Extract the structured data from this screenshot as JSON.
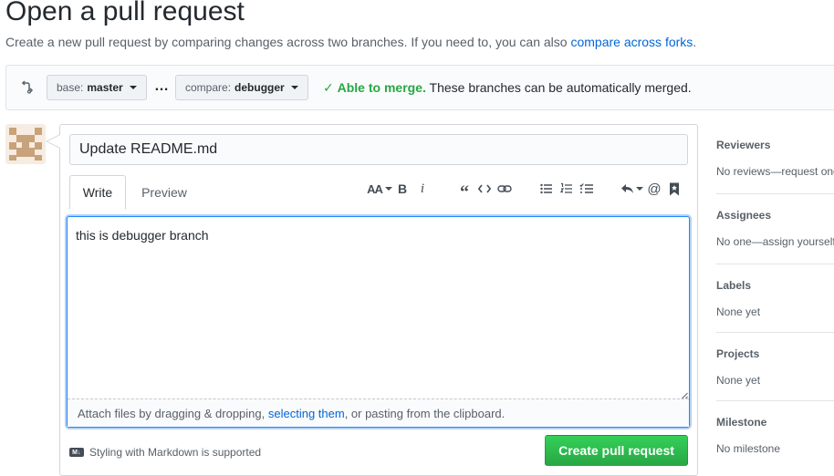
{
  "page": {
    "title": "Open a pull request",
    "subtitle_prefix": "Create a new pull request by comparing changes across two branches. If you need to, you can also ",
    "subtitle_link": "compare across forks",
    "subtitle_suffix": "."
  },
  "range": {
    "base_label": "base:",
    "base_value": "master",
    "separator": "…",
    "compare_label": "compare:",
    "compare_value": "debugger",
    "merge_check": "✓",
    "merge_status": "Able to merge.",
    "merge_detail": "These branches can be automatically merged."
  },
  "form": {
    "title_value": "Update README.md",
    "tabs": {
      "write": "Write",
      "preview": "Preview"
    },
    "toolbar": {
      "icons": [
        "text-size-icon",
        "bold-icon",
        "italic-icon",
        "quote-icon",
        "code-icon",
        "link-icon",
        "unordered-list-icon",
        "ordered-list-icon",
        "task-list-icon",
        "reply-icon",
        "mention-icon",
        "bookmark-icon"
      ],
      "text_size_label": "AA",
      "bold_label": "B",
      "italic_label": "i",
      "quote_label": "“",
      "mention_label": "@"
    },
    "body_value": "this is debugger branch",
    "attach_prefix": "Attach files by dragging & dropping, ",
    "attach_link": "selecting them",
    "attach_suffix": ", or pasting from the clipboard.",
    "markdown_icon_label": "M↓",
    "markdown_note": "Styling with Markdown is supported",
    "submit_label": "Create pull request"
  },
  "sidebar": [
    {
      "heading": "Reviewers",
      "value": "No reviews—request one"
    },
    {
      "heading": "Assignees",
      "value": "No one—assign yourself"
    },
    {
      "heading": "Labels",
      "value": "None yet"
    },
    {
      "heading": "Projects",
      "value": "None yet"
    },
    {
      "heading": "Milestone",
      "value": "No milestone"
    }
  ],
  "colors": {
    "link": "#0366d6",
    "success": "#28a745",
    "focus_border": "#2188ff",
    "button_green": "#28a745"
  }
}
